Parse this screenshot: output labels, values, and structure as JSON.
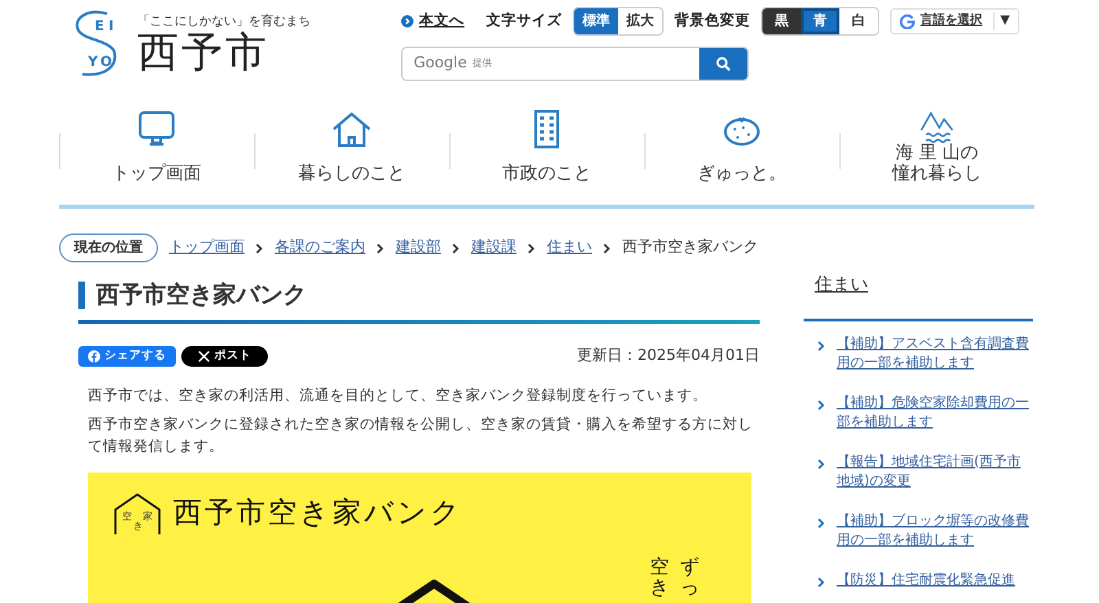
{
  "header": {
    "tagline": "「ここにしかない」を育むまち",
    "logo_letters": [
      "E",
      "I",
      "Y",
      "O"
    ],
    "site_name": "西予市",
    "skip_link": "本文へ",
    "font_size": {
      "label": "文字サイズ",
      "options": [
        {
          "label": "標準",
          "selected": true
        },
        {
          "label": "拡大",
          "selected": false
        }
      ]
    },
    "bg_color": {
      "label": "背景色変更",
      "options": [
        {
          "label": "黒",
          "kind": "dark",
          "selected": false
        },
        {
          "label": "青",
          "kind": "blue",
          "selected": true
        },
        {
          "label": "白",
          "kind": "white",
          "selected": false
        }
      ]
    },
    "translate": {
      "label": "言語を選択",
      "caret": "▼"
    },
    "search": {
      "placeholder_brand": "Google",
      "placeholder_note": "提供"
    }
  },
  "nav": [
    {
      "lines": [
        "トップ画面"
      ]
    },
    {
      "lines": [
        "暮らしのこと"
      ]
    },
    {
      "lines": [
        "市政のこと"
      ]
    },
    {
      "lines": [
        "ぎゅっと。"
      ]
    },
    {
      "lines": [
        "海 里 山の",
        "憧れ暮らし"
      ]
    }
  ],
  "breadcrumb": {
    "label": "現在の位置",
    "links": [
      "トップ画面",
      "各課のご案内",
      "建設部",
      "建設課",
      "住まい"
    ],
    "current": "西予市空き家バンク"
  },
  "article": {
    "title": "西予市空き家バンク",
    "share": [
      {
        "label": "シェアする",
        "kind": "facebook"
      },
      {
        "label": "ポスト",
        "kind": "x"
      }
    ],
    "updated": "更新日：2025年04月01日",
    "paragraphs": [
      "西予市では、空き家の利活用、流通を目的として、空き家バンク登録制度を行っています。",
      "西予市空き家バンクに登録された空き家の情報を公開し、空き家の賃貸・購入を希望する方に対して情報発信します。"
    ],
    "banner": {
      "logo_text": [
        "空",
        "き",
        "家"
      ],
      "title": "西予市空き家バンク",
      "vertical_texts": [
        "空き",
        "ずっ"
      ]
    }
  },
  "sidebar": {
    "title": "住まい",
    "links": [
      "【補助】アスベスト含有調査費用の一部を補助します",
      "【補助】危険空家除却費用の一部を補助します",
      "【報告】地域住宅計画(西予市地域)の変更",
      "【補助】ブロック塀等の改修費用の一部を補助します",
      "【防災】住宅耐震化緊急促進"
    ]
  }
}
